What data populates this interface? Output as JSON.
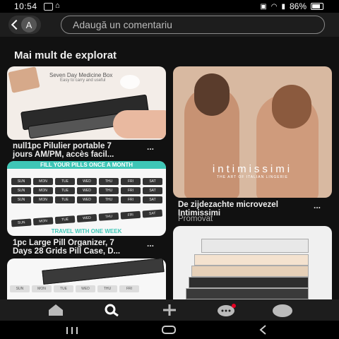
{
  "status": {
    "time": "10:54",
    "battery": "86%"
  },
  "topbar": {
    "avatar_letter": "A",
    "comment_placeholder": "Adaugă un comentariu"
  },
  "section_title": "Mai mult de explorat",
  "pins": [
    {
      "id": "pin1",
      "caption_line1": "null1pc Pilulier portable 7",
      "caption_line2": "jours AM/PM, accès facil...",
      "image_title": "Seven Day Medicine Box",
      "image_sub": "Easy to carry and useful"
    },
    {
      "id": "pin2",
      "caption_line1": "De zijdezachte microvezel",
      "caption_line2": "Intimissimi",
      "promoted": "Promovat",
      "brand": "intimissimi",
      "brand_tag": "THE ART OF ITALIAN LINGERIE"
    },
    {
      "id": "pin3",
      "caption_line1": "1pc Large Pill Organizer, 7",
      "caption_line2": "Days 28 Grids Pill Case, D...",
      "band_top": "FILL YOUR PILLS ONCE A MONTH",
      "band_bottom": "TRAVEL WITH ONE WEEK",
      "days": [
        "SUN",
        "MON",
        "TUE",
        "WED",
        "THU",
        "FRI",
        "SAT"
      ]
    },
    {
      "id": "pin4"
    },
    {
      "id": "pin5"
    }
  ],
  "more": "..."
}
